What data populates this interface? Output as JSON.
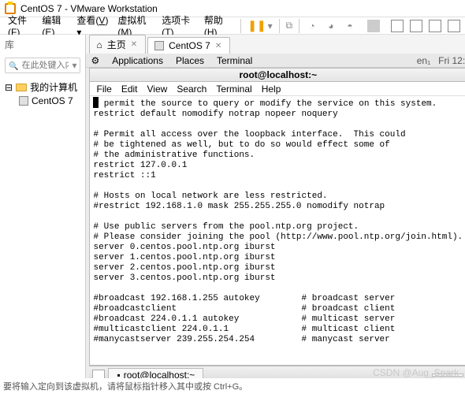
{
  "titlebar": {
    "text": "CentOS 7 - VMware Workstation"
  },
  "menubar": {
    "items": [
      {
        "label": "文件",
        "key": "F"
      },
      {
        "label": "编辑",
        "key": "E"
      },
      {
        "label": "查看",
        "key": "V"
      },
      {
        "label": "虚拟机",
        "key": "M"
      },
      {
        "label": "选项卡",
        "key": "T"
      },
      {
        "label": "帮助",
        "key": "H"
      }
    ]
  },
  "sidebar": {
    "title": "库",
    "search_placeholder": "在此处键入内容…",
    "root": "我的计算机",
    "vm": "CentOS 7"
  },
  "tabs": {
    "home": "主页",
    "vm": "CentOS 7"
  },
  "gnome": {
    "apps": "Applications",
    "places": "Places",
    "terminal": "Terminal",
    "lang": "en₁",
    "time": "Fri 12:"
  },
  "window": {
    "title": "root@localhost:~"
  },
  "term_menu": {
    "file": "File",
    "edit": "Edit",
    "view": "View",
    "search": "Search",
    "terminal": "Terminal",
    "help": "Help"
  },
  "term_lines": "# permit the source to query or modify the service on this system.\nrestrict default nomodify notrap nopeer noquery\n\n# Permit all access over the loopback interface.  This could\n# be tightened as well, but to do so would effect some of\n# the administrative functions.\nrestrict 127.0.0.1\nrestrict ::1\n\n# Hosts on local network are less restricted.\n#restrict 192.168.1.0 mask 255.255.255.0 nomodify notrap\n\n# Use public servers from the pool.ntp.org project.\n# Please consider joining the pool (http://www.pool.ntp.org/join.html).\nserver 0.centos.pool.ntp.org iburst\nserver 1.centos.pool.ntp.org iburst\nserver 2.centos.pool.ntp.org iburst\nserver 3.centos.pool.ntp.org iburst\n\n#broadcast 192.168.1.255 autokey        # broadcast server\n#broadcastclient                        # broadcast client\n#broadcast 224.0.1.1 autokey            # multicast server\n#multicastclient 224.0.1.1              # multicast client\n#manycastserver 239.255.254.254         # manycast server",
  "taskbar": {
    "item": "root@localhost:~"
  },
  "status": "要将输入定向到该虚拟机，请将鼠标指针移入其中或按 Ctrl+G。",
  "watermark": "CSDN @Aug_Spark"
}
